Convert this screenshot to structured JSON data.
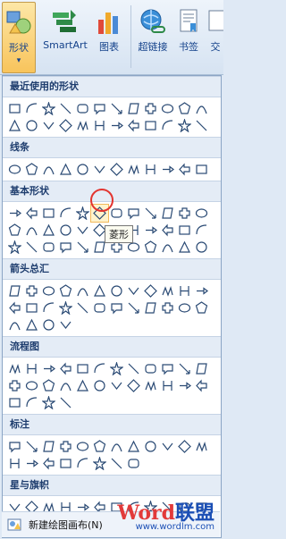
{
  "ribbon": {
    "buttons": [
      {
        "label": "形状",
        "icon": "shapes-icon",
        "active": true,
        "dropdown": "▾"
      },
      {
        "label": "SmartArt",
        "icon": "smartart-icon"
      },
      {
        "label": "图表",
        "icon": "chart-icon"
      },
      {
        "label": "超链接",
        "icon": "hyperlink-icon"
      },
      {
        "label": "书签",
        "icon": "bookmark-icon"
      },
      {
        "label": "交",
        "icon": "cross-reference-icon"
      }
    ]
  },
  "sections": [
    {
      "title": "最近使用的形状",
      "count": 24
    },
    {
      "title": "线条",
      "count": 12
    },
    {
      "title": "基本形状",
      "count": 36
    },
    {
      "title": "箭头总汇",
      "count": 28
    },
    {
      "title": "流程图",
      "count": 28
    },
    {
      "title": "标注",
      "count": 20
    },
    {
      "title": "星与旗帜",
      "count": 20
    }
  ],
  "tooltip": "菱形",
  "footer": {
    "label": "新建绘图画布(N)",
    "icon": "new-canvas-icon"
  },
  "watermark": {
    "brand_latin": "Word",
    "brand_cn": "联盟",
    "url": "www.wordlm.com"
  }
}
